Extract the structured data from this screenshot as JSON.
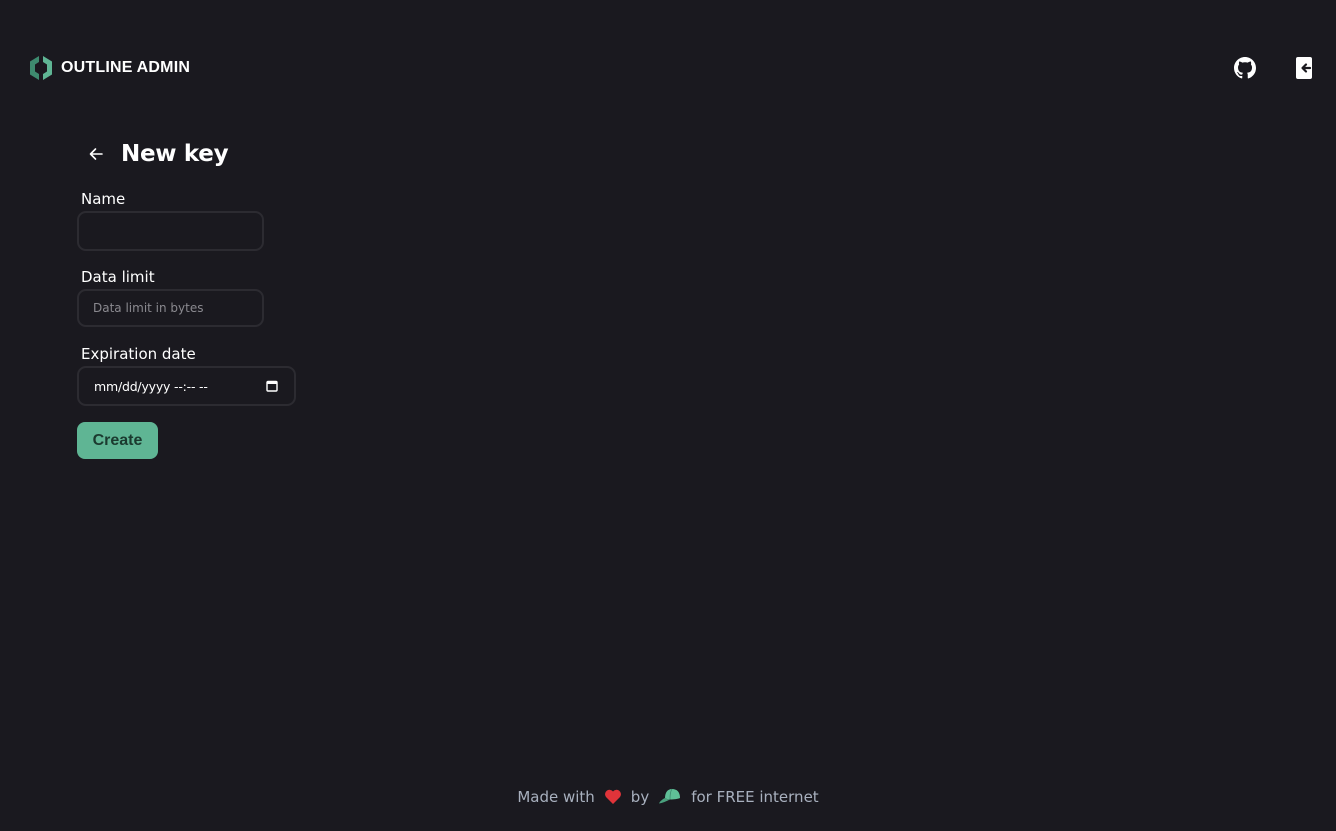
{
  "header": {
    "brand_title": "OUTLINE ADMIN",
    "logo_icon": "outline-hexagon-logo",
    "actions": [
      {
        "name": "github-link",
        "icon": "github-icon"
      },
      {
        "name": "logout-button",
        "icon": "logout-icon"
      }
    ]
  },
  "page": {
    "back_icon": "arrow-left-icon",
    "title": "New key"
  },
  "form": {
    "name": {
      "label": "Name",
      "value": "",
      "placeholder": ""
    },
    "data_limit": {
      "label": "Data limit",
      "value": "",
      "placeholder": "Data limit in bytes"
    },
    "expiration": {
      "label": "Expiration date",
      "value": "",
      "placeholder": "mm/dd/yyyy --:-- --",
      "icon": "calendar-icon"
    },
    "submit_label": "Create"
  },
  "footer": {
    "made_with": "Made with",
    "heart_icon": "heart-icon",
    "by": "by",
    "cap_icon": "cap-icon",
    "tagline": "for FREE internet"
  },
  "colors": {
    "background": "#1a191f",
    "accent": "#5fb594",
    "heart": "#e0343a"
  }
}
